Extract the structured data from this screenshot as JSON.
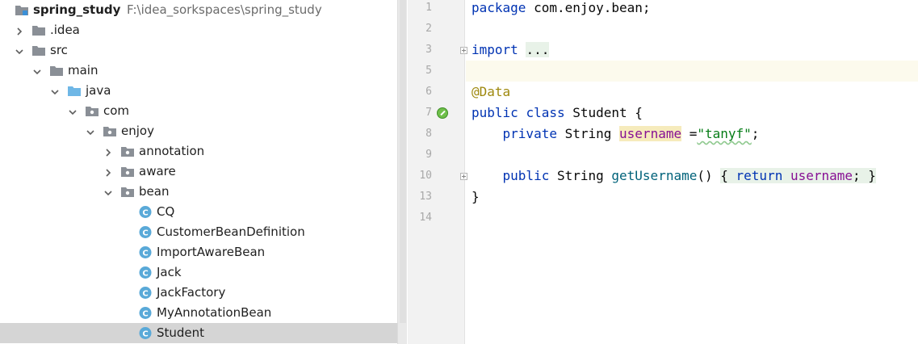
{
  "project_tree": {
    "items": [
      {
        "label": "spring_study",
        "path": "F:\\idea_sorkspaces\\spring_study",
        "kind": "module",
        "depth": 0,
        "expanded": null,
        "root": true
      },
      {
        "label": ".idea",
        "kind": "folder",
        "depth": 1,
        "expanded": false
      },
      {
        "label": "src",
        "kind": "folder",
        "depth": 1,
        "expanded": true
      },
      {
        "label": "main",
        "kind": "folder",
        "depth": 2,
        "expanded": true
      },
      {
        "label": "java",
        "kind": "source-folder",
        "depth": 3,
        "expanded": true
      },
      {
        "label": "com",
        "kind": "package",
        "depth": 4,
        "expanded": true
      },
      {
        "label": "enjoy",
        "kind": "package",
        "depth": 5,
        "expanded": true
      },
      {
        "label": "annotation",
        "kind": "package",
        "depth": 6,
        "expanded": false
      },
      {
        "label": "aware",
        "kind": "package",
        "depth": 6,
        "expanded": false
      },
      {
        "label": "bean",
        "kind": "package",
        "depth": 6,
        "expanded": true
      },
      {
        "label": "CQ",
        "kind": "class",
        "depth": 7
      },
      {
        "label": "CustomerBeanDefinition",
        "kind": "class",
        "depth": 7
      },
      {
        "label": "ImportAwareBean",
        "kind": "class",
        "depth": 7
      },
      {
        "label": "Jack",
        "kind": "class",
        "depth": 7
      },
      {
        "label": "JackFactory",
        "kind": "class",
        "depth": 7
      },
      {
        "label": "MyAnnotationBean",
        "kind": "class",
        "depth": 7
      },
      {
        "label": "Student",
        "kind": "class",
        "depth": 7,
        "selected": true
      }
    ]
  },
  "editor": {
    "lines": [
      {
        "num": "1",
        "tokens": [
          {
            "t": "package",
            "c": "kw"
          },
          {
            "t": " com.enjoy.bean;"
          }
        ]
      },
      {
        "num": "2",
        "tokens": []
      },
      {
        "num": "3",
        "fold": true,
        "tokens": [
          {
            "t": "import",
            "c": "kw"
          },
          {
            "t": " "
          },
          {
            "t": "...",
            "c": "fold-box"
          }
        ]
      },
      {
        "num": "5",
        "current": true,
        "tokens": []
      },
      {
        "num": "6",
        "tokens": [
          {
            "t": "@Data",
            "c": "ann"
          }
        ]
      },
      {
        "num": "7",
        "marker": true,
        "tokens": [
          {
            "t": "public",
            "c": "kw"
          },
          {
            "t": " "
          },
          {
            "t": "class",
            "c": "kw"
          },
          {
            "t": " Student {"
          }
        ]
      },
      {
        "num": "8",
        "tokens": [
          {
            "t": "    "
          },
          {
            "t": "private",
            "c": "kw"
          },
          {
            "t": " String "
          },
          {
            "t": "username",
            "c": "field hl-var"
          },
          {
            "t": " ="
          },
          {
            "t": "\"tanyf\"",
            "c": "str str-under"
          },
          {
            "t": ";"
          }
        ]
      },
      {
        "num": "9",
        "tokens": []
      },
      {
        "num": "10",
        "fold": true,
        "tokens": [
          {
            "t": "    "
          },
          {
            "t": "public",
            "c": "kw"
          },
          {
            "t": " String "
          },
          {
            "t": "getUsername",
            "c": "method"
          },
          {
            "t": "() "
          },
          {
            "t": "{ ",
            "c": "fold-box"
          },
          {
            "t": "return",
            "c": "kw fold-box"
          },
          {
            "t": " ",
            "c": "fold-box"
          },
          {
            "t": "username",
            "c": "field fold-box"
          },
          {
            "t": "; }",
            "c": "fold-box"
          }
        ]
      },
      {
        "num": "13",
        "tokens": [
          {
            "t": "}"
          }
        ]
      },
      {
        "num": "14",
        "tokens": []
      }
    ]
  },
  "colors": {
    "folder": "#8a8f96",
    "source_folder": "#6fb7e6",
    "class_icon": "#59a9d8",
    "selection": "#d5d5d5"
  }
}
